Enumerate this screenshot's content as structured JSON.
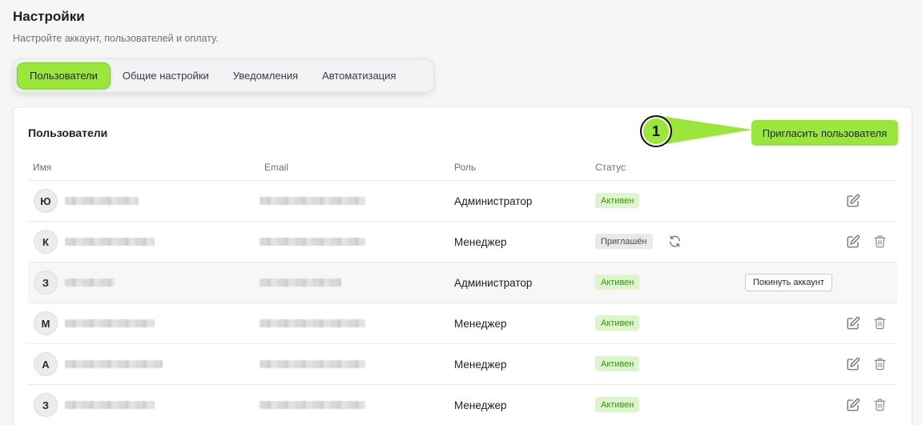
{
  "page": {
    "title": "Настройки",
    "subtitle": "Настройте аккаунт, пользователей и оплату."
  },
  "tabs": [
    {
      "label": "Пользователи",
      "active": true
    },
    {
      "label": "Общие настройки",
      "active": false
    },
    {
      "label": "Уведомления",
      "active": false
    },
    {
      "label": "Автоматизация",
      "active": false
    }
  ],
  "users_card": {
    "title": "Пользователи",
    "invite_label": "Пригласить пользователя",
    "marker": "1",
    "columns": {
      "name": "Имя",
      "email": "Email",
      "role": "Роль",
      "status": "Статус"
    },
    "rows": [
      {
        "initial": "Ю",
        "role": "Администратор",
        "status": "Активен"
      },
      {
        "initial": "К",
        "role": "Менеджер",
        "status": "Приглашён"
      },
      {
        "initial": "З",
        "role": "Администратор",
        "status": "Активен",
        "leave_label": "Покинуть аккаунт"
      },
      {
        "initial": "М",
        "role": "Менеджер",
        "status": "Активен"
      },
      {
        "initial": "А",
        "role": "Менеджер",
        "status": "Активен"
      },
      {
        "initial": "З",
        "role": "Менеджер",
        "status": "Активен"
      }
    ]
  },
  "icons": {
    "edit": "edit-icon",
    "delete": "trash-icon",
    "resend": "refresh-icon"
  },
  "colors": {
    "accent": "#9be63c",
    "active_badge_bg": "#ddf5cd",
    "active_badge_text": "#3e8f18"
  }
}
